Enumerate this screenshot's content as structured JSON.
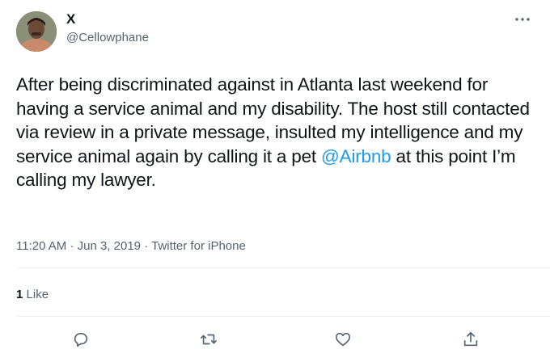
{
  "tweet": {
    "display_name": "X",
    "handle": "@Cellowphane",
    "text_before_mention": "After being discriminated against in Atlanta last weekend for having a service animal and my disability. The host still contacted via review in a private message, insulted my intelligence and my service animal again by calling it a pet ",
    "mention": "@Airbnb",
    "text_after_mention": " at this point I’m calling my lawyer.",
    "time": "11:20 AM",
    "date": "Jun 3, 2019",
    "source": "Twitter for iPhone",
    "like_count": "1",
    "like_label": "Like"
  },
  "colors": {
    "text": "#0f1419",
    "secondary": "#536471",
    "mention": "#1d9bf0",
    "divider": "#eff3f4"
  },
  "icons": {
    "more": "more-icon",
    "reply": "reply-icon",
    "retweet": "retweet-icon",
    "like": "like-icon",
    "share": "share-icon"
  }
}
